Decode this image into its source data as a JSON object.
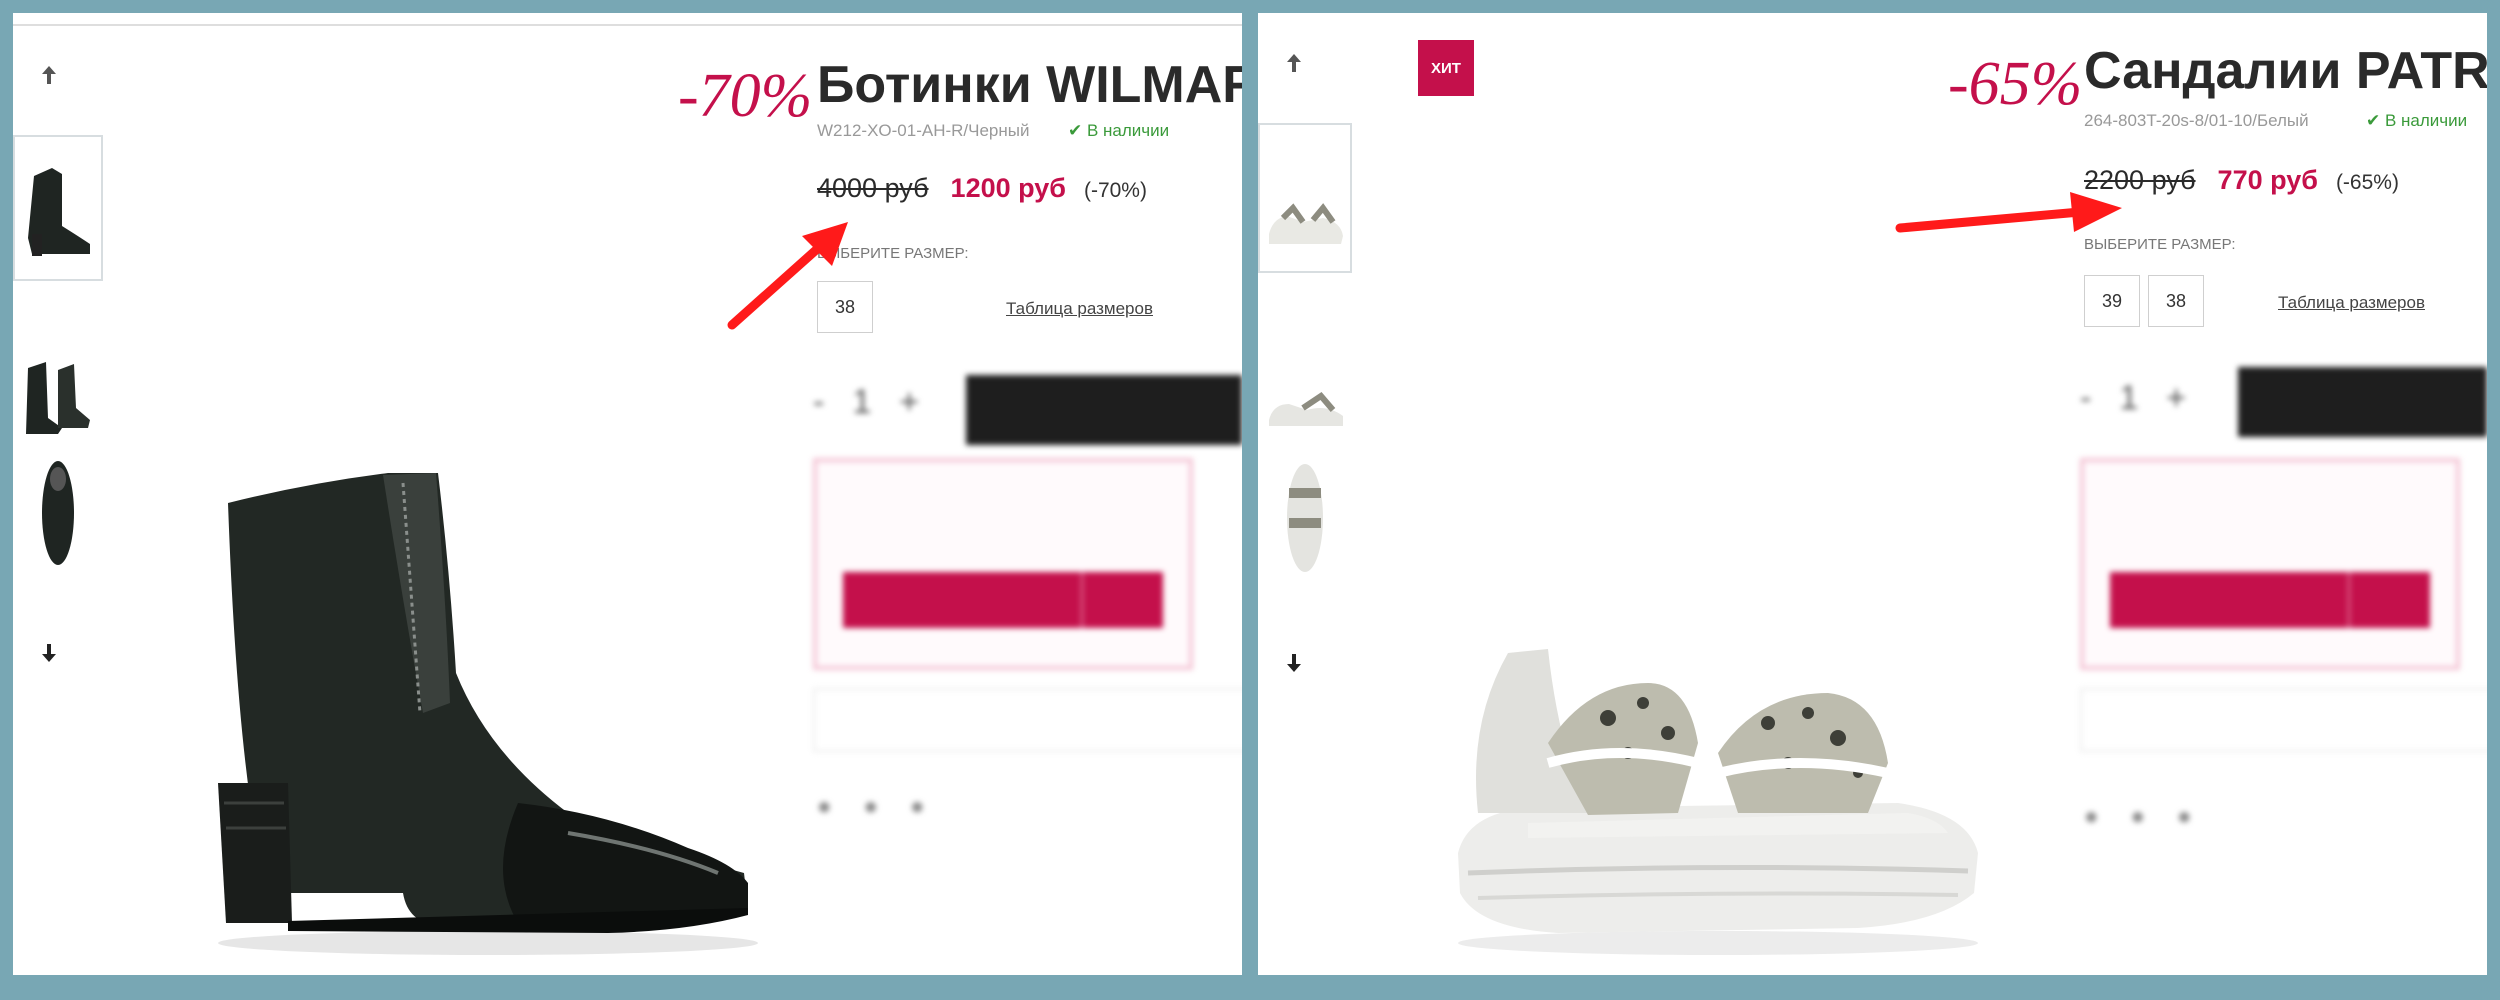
{
  "colors": {
    "accent": "#c4104b",
    "stock": "#3a9a3a",
    "frame": "#78a7b4",
    "arrow": "#ff1a1a"
  },
  "left": {
    "discount_badge": "-70%",
    "title": "Ботинки WILMAR",
    "sku": "W212-XO-01-AH-R/Черный",
    "stock_icon": "check-icon",
    "stock": "В наличии",
    "old_price": "4000 руб",
    "new_price": "1200 руб",
    "discount_pct": "(-70%)",
    "size_label": "ВЫБЕРИТЕ РАЗМЕР:",
    "sizes": [
      "38"
    ],
    "size_table_link": "Таблица размеров",
    "nav_up_icon": "arrow-up-icon",
    "nav_down_icon": "arrow-down-icon",
    "product_image": "black-ankle-boot",
    "thumbnails": [
      "black-ankle-boot-side",
      "black-ankle-boot-pair",
      "black-ankle-boot-top"
    ]
  },
  "right": {
    "hit_badge": "ХИТ",
    "discount_badge": "-65%",
    "title": "Сандалии PATR",
    "sku": "264-803T-20s-8/01-10/Белый",
    "stock_icon": "check-icon",
    "stock": "В наличии",
    "old_price": "2200 руб",
    "new_price": "770 руб",
    "discount_pct": "(-65%)",
    "size_label": "ВЫБЕРИТЕ РАЗМЕР:",
    "sizes": [
      "39",
      "38"
    ],
    "size_table_link": "Таблица размеров",
    "nav_up_icon": "arrow-up-icon",
    "nav_down_icon": "arrow-down-icon",
    "product_image": "white-snake-print-sandal",
    "thumbnails": [
      "sandal-pair",
      "sandal-side",
      "sandal-top"
    ]
  }
}
